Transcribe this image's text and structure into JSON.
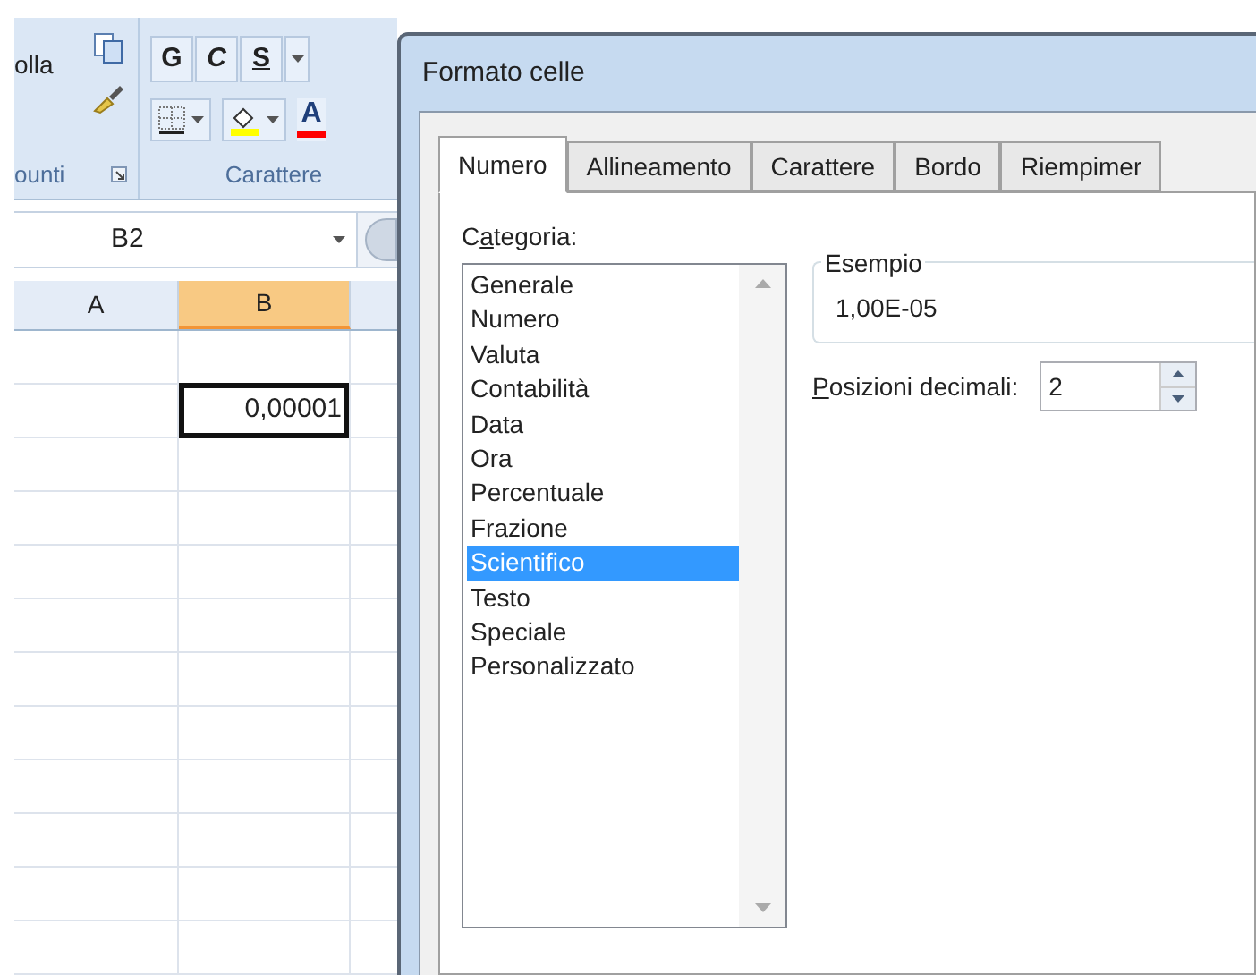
{
  "ribbon": {
    "paste_label": "olla",
    "clipboard_group": "ounti",
    "font_buttons": [
      {
        "label": "G",
        "kind": "bold"
      },
      {
        "label": "C",
        "kind": "italic"
      },
      {
        "label": "S",
        "kind": "underline"
      }
    ],
    "font_color_letter": "A",
    "font_group": "Carattere"
  },
  "name_box": "B2",
  "columns": [
    {
      "label": "A",
      "selected": false
    },
    {
      "label": "B",
      "selected": true
    }
  ],
  "active_cell": {
    "value": "0,00001"
  },
  "dialog": {
    "title": "Formato celle",
    "tabs": [
      {
        "label": "Numero",
        "selected": true
      },
      {
        "label": "Allineamento",
        "selected": false
      },
      {
        "label": "Carattere",
        "selected": false
      },
      {
        "label": "Bordo",
        "selected": false
      },
      {
        "label": "Riempimer",
        "selected": false
      }
    ],
    "category_label": {
      "before": "C",
      "key": "a",
      "after": "tegoria:"
    },
    "categories": [
      {
        "label": "Generale",
        "selected": false
      },
      {
        "label": "Numero",
        "selected": false
      },
      {
        "label": "Valuta",
        "selected": false
      },
      {
        "label": "Contabilità",
        "selected": false
      },
      {
        "label": "Data",
        "selected": false
      },
      {
        "label": "Ora",
        "selected": false
      },
      {
        "label": "Percentuale",
        "selected": false
      },
      {
        "label": "Frazione",
        "selected": false
      },
      {
        "label": "Scientifico",
        "selected": true
      },
      {
        "label": "Testo",
        "selected": false
      },
      {
        "label": "Speciale",
        "selected": false
      },
      {
        "label": "Personalizzato",
        "selected": false
      }
    ],
    "sample_label": "Esempio",
    "sample_value": "1,00E-05",
    "decimals_label": {
      "key": "P",
      "after": "osizioni decimali:"
    },
    "decimals_value": "2"
  }
}
